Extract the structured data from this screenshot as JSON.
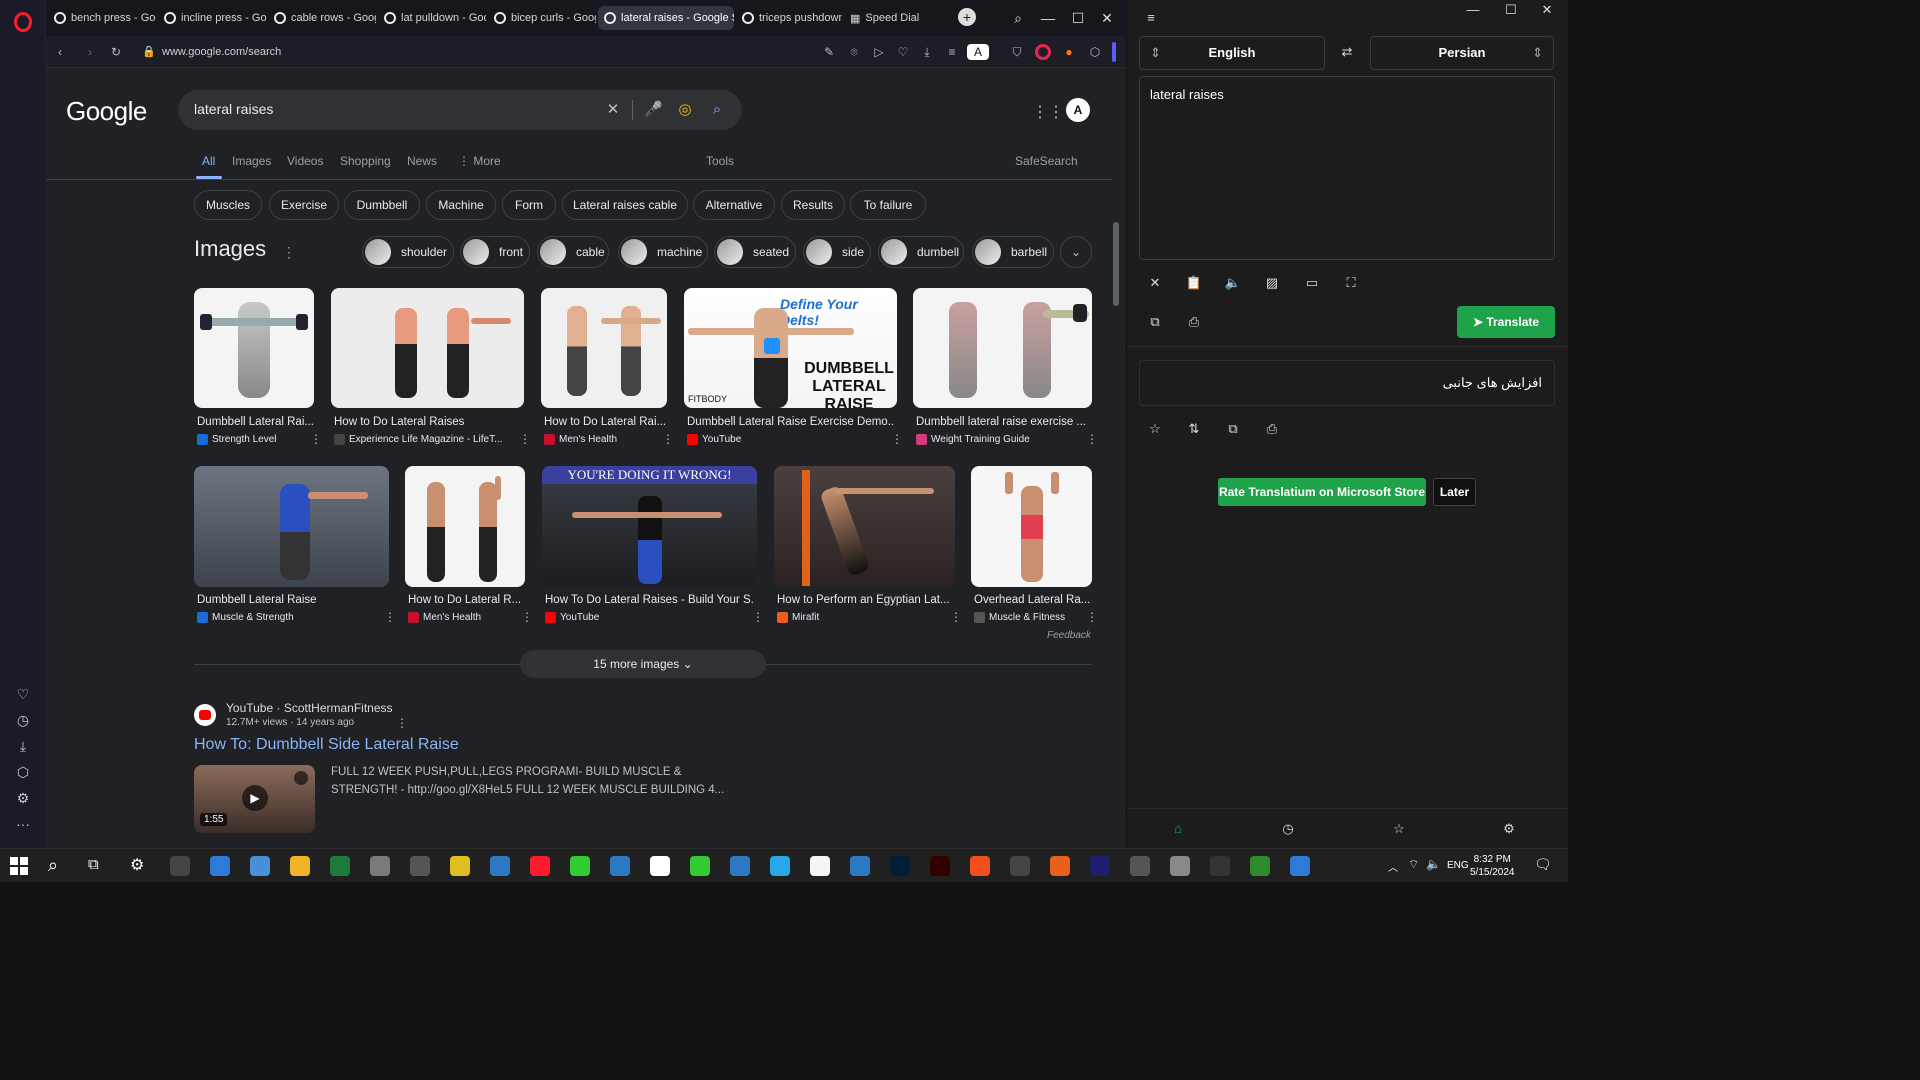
{
  "opera_sidebar": {
    "icons": [
      "opera-logo",
      "heart-icon",
      "history-icon",
      "download-icon",
      "cube-icon",
      "gear-icon",
      "more-icon"
    ]
  },
  "tabs": [
    {
      "label": "bench press - Goog"
    },
    {
      "label": "incline press - Goog"
    },
    {
      "label": "cable rows - Google"
    },
    {
      "label": "lat pulldown - Goog"
    },
    {
      "label": "bicep curls - Google"
    },
    {
      "label": "lateral raises - Google Sea"
    },
    {
      "label": "triceps pushdown -"
    },
    {
      "label": "Speed Dial"
    }
  ],
  "address": {
    "url": "www.google.com/search"
  },
  "google": {
    "logo": "Google",
    "query": "lateral raises",
    "nav": {
      "all": "All",
      "images": "Images",
      "videos": "Videos",
      "shopping": "Shopping",
      "news": "News",
      "more": "More",
      "tools": "Tools",
      "safesearch": "SafeSearch"
    },
    "chips": [
      "Muscles",
      "Exercise",
      "Dumbbell",
      "Machine",
      "Form",
      "Lateral raises cable",
      "Alternative",
      "Results",
      "To failure"
    ],
    "images_title": "Images",
    "image_chips": [
      "shoulder",
      "front",
      "cable",
      "machine",
      "seated",
      "side",
      "dumbell",
      "barbell"
    ],
    "row1": [
      {
        "title": "Dumbbell Lateral Rai...",
        "source": "Strength Level",
        "color": "#1a6dd6"
      },
      {
        "title": "How to Do Lateral Raises",
        "source": "Experience Life Magazine - LifeT...",
        "color": "#444"
      },
      {
        "title": "How to Do Lateral Rai...",
        "source": "Men's Health",
        "color": "#c8102e"
      },
      {
        "title": "Dumbbell Lateral Raise Exercise Demo...",
        "source": "YouTube",
        "color": "#ff0000"
      },
      {
        "title": "Dumbbell lateral raise exercise ...",
        "source": "Weight Training Guide",
        "color": "#d63a7e"
      }
    ],
    "row1_overlay": {
      "define": "Define Your Delts!",
      "dumbbell": "DUMBBELL",
      "lateral": "LATERAL RAISE",
      "fitbody": "FITBODY"
    },
    "row2": [
      {
        "title": "Dumbbell Lateral Raise",
        "source": "Muscle & Strength",
        "color": "#1a6dd6"
      },
      {
        "title": "How to Do Lateral R...",
        "source": "Men's Health",
        "color": "#c8102e"
      },
      {
        "title": "How To Do Lateral Raises - Build Your S...",
        "source": "YouTube",
        "color": "#ff0000"
      },
      {
        "title": "How to Perform an Egyptian Lat...",
        "source": "Mirafit",
        "color": "#e8601c"
      },
      {
        "title": "Overhead Lateral Ra...",
        "source": "Muscle & Fitness",
        "color": "#555"
      }
    ],
    "row2_overlay": {
      "wrong": "YOU'RE DOING IT WRONG!"
    },
    "feedback": "Feedback",
    "more_images": "15 more images",
    "result": {
      "channel": "YouTube · ScottHermanFitness",
      "meta": "12.7M+ views · 14 years ago",
      "title": "How To: Dumbbell Side Lateral Raise",
      "snippet": "FULL 12 WEEK PUSH,PULL,LEGS PROGRAMI- BUILD MUSCLE & STRENGTH! - http://goo.gl/X8HeL5 FULL 12 WEEK MUSCLE BUILDING 4...",
      "duration": "1:55"
    }
  },
  "translator": {
    "source_lang": "English",
    "target_lang": "Persian",
    "input": "lateral raises",
    "translate_button": "Translate",
    "output": "افزایش های جانبی",
    "rate_button": "Rate Translatium on Microsoft Store",
    "later_button": "Later"
  },
  "taskbar": {
    "lang": "ENG",
    "time": "8:32 PM",
    "date": "5/15/2024",
    "colors": [
      "#444",
      "#2d7bd6",
      "#4a90d9",
      "#f0b428",
      "#1d7b3a",
      "#7a7a7a",
      "#555",
      "#e0c020",
      "#2a79c2",
      "#ff1b2d",
      "#3c3",
      "#2a79c2",
      "#fff",
      "#3c3",
      "#2a79c2",
      "#27a7e7",
      "#f5f5f5",
      "#2a79c2",
      "#001e36",
      "#330000",
      "#f24e1e",
      "#444",
      "#e8601c",
      "#1e1e6e",
      "#555",
      "#888",
      "#333",
      "#2d8a2d",
      "#2d7bd6"
    ]
  }
}
